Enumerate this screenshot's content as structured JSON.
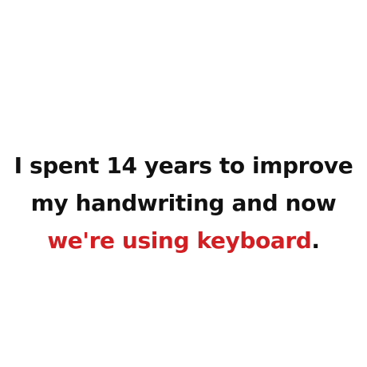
{
  "meme": {
    "line1": "I spent 14 years to improve",
    "line2": "my handwriting and now",
    "line3_highlight": "we're using keyboard",
    "line3_end": "."
  },
  "colors": {
    "background": "#ffffff",
    "text": "#111111",
    "accent": "#d21f24"
  }
}
